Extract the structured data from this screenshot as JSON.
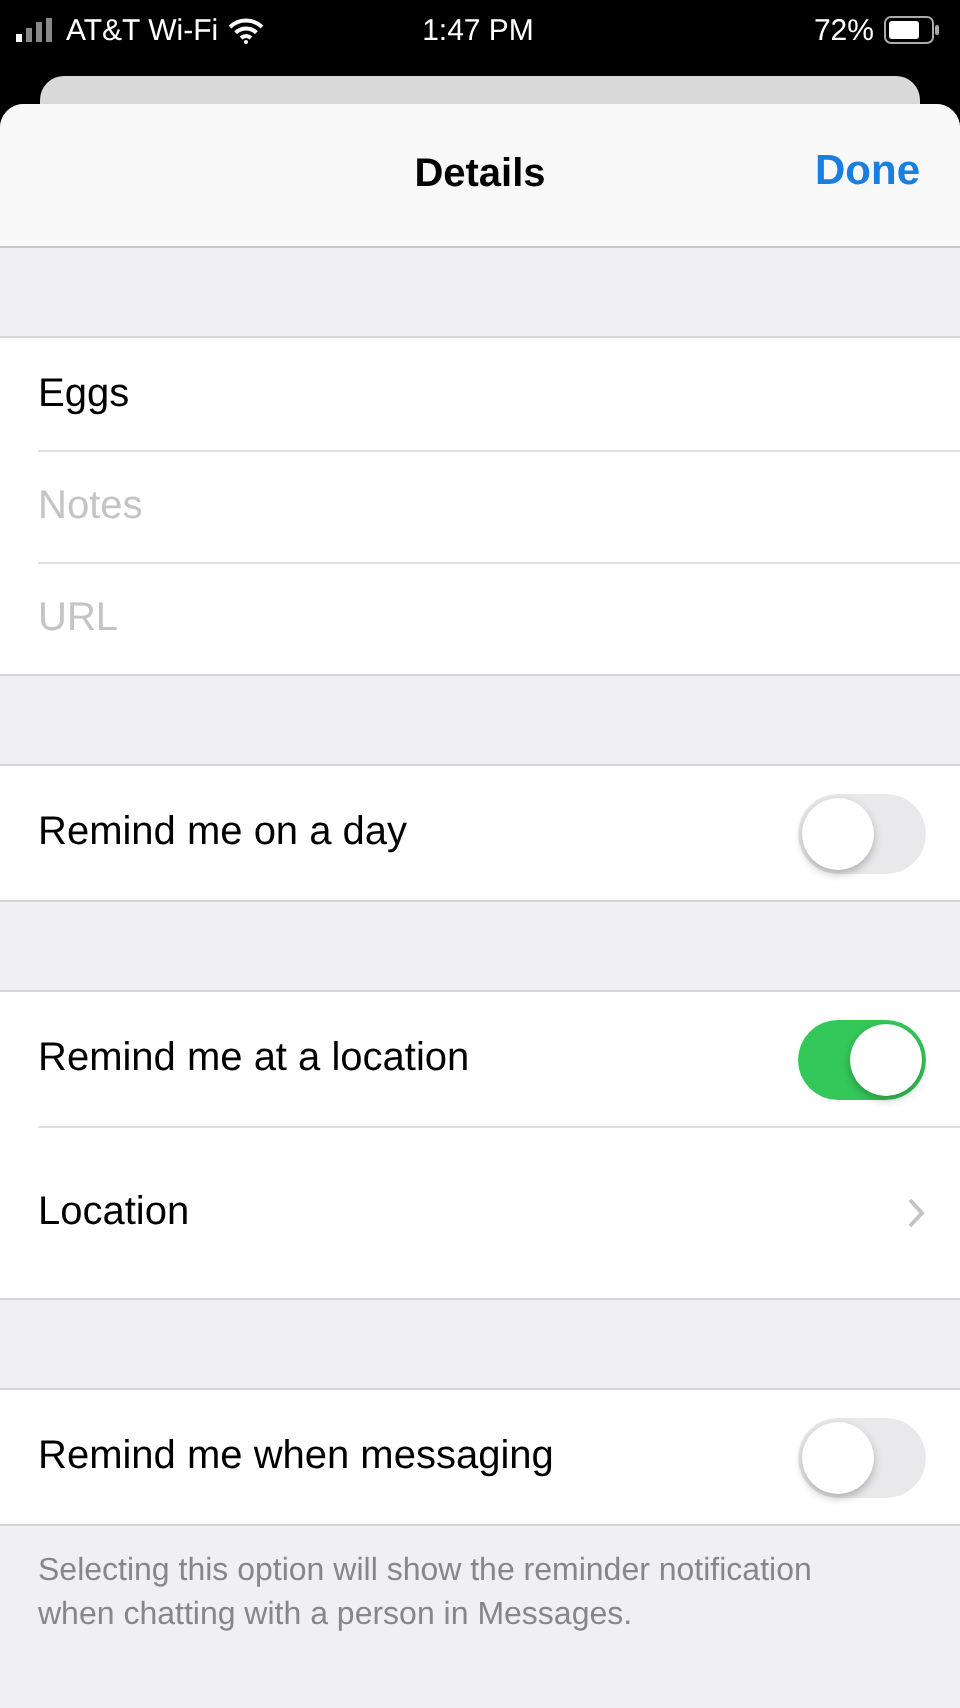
{
  "status_bar": {
    "carrier": "AT&T Wi-Fi",
    "time": "1:47 PM",
    "battery": "72%"
  },
  "header": {
    "title": "Details",
    "action": "Done"
  },
  "sections": [
    {
      "rows": [
        {
          "kind": "field",
          "value": "Eggs"
        },
        {
          "kind": "field",
          "placeholder": "Notes"
        },
        {
          "kind": "field",
          "placeholder": "URL"
        }
      ]
    },
    {
      "rows": [
        {
          "kind": "toggle",
          "label": "Remind me on a day",
          "on": false
        }
      ]
    },
    {
      "rows": [
        {
          "kind": "toggle",
          "label": "Remind me at a location",
          "on": true
        },
        {
          "kind": "link",
          "label": "Location"
        }
      ]
    },
    {
      "rows": [
        {
          "kind": "toggle",
          "label": "Remind me when messaging",
          "on": false
        }
      ],
      "footer": "Selecting this option will show the reminder notification when chatting with a person in Messages."
    }
  ]
}
